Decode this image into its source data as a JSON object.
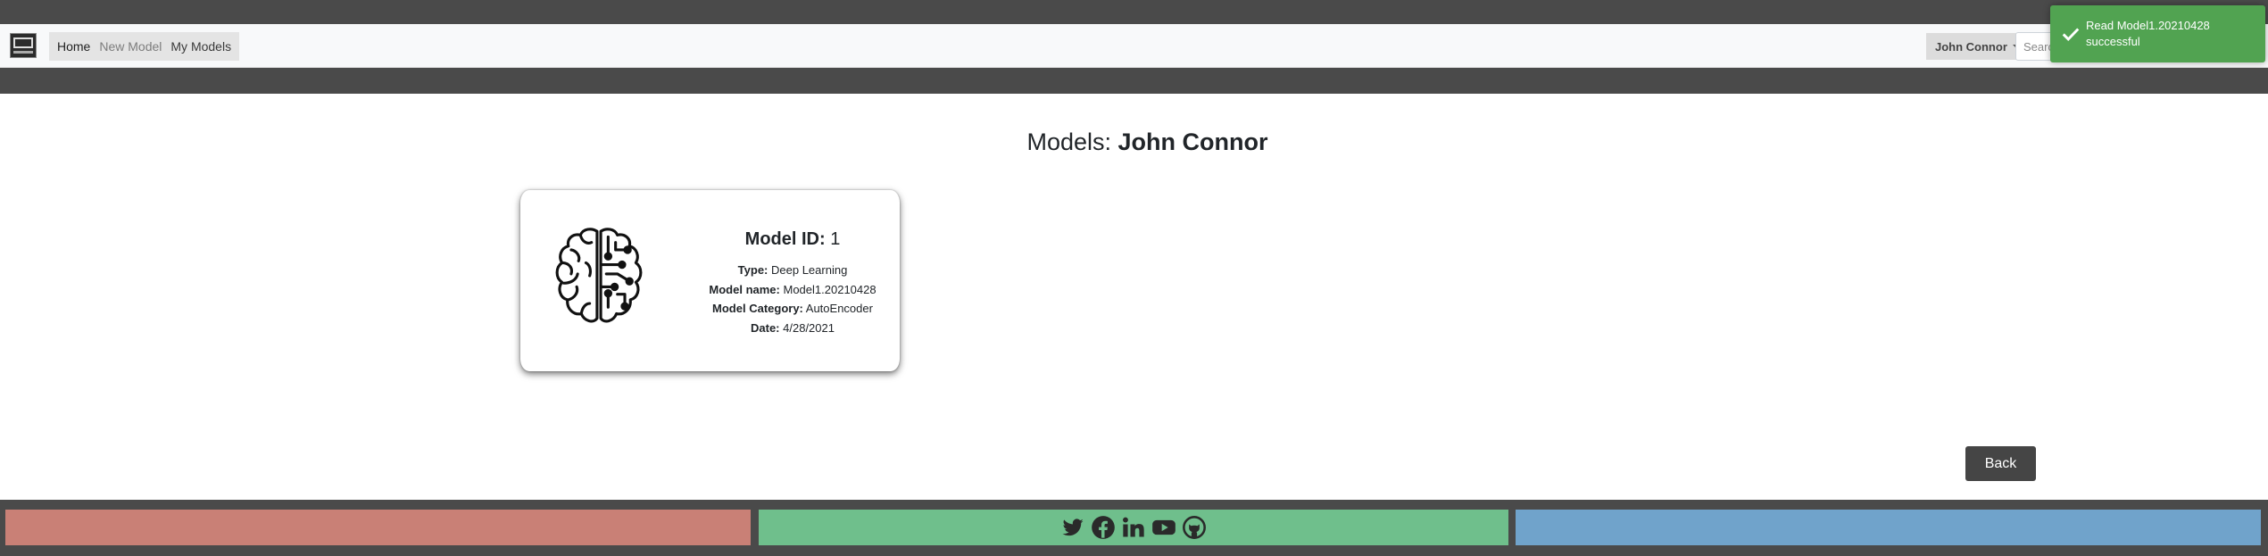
{
  "navbar": {
    "logo": "site-logo",
    "links": [
      "Home",
      "New Model",
      "My Models"
    ],
    "user": "John Connor",
    "search_placeholder": "Search"
  },
  "toast": {
    "message": "Read Model1.20210428 successful",
    "icon": "check-icon",
    "color": "#51a351"
  },
  "page": {
    "title_prefix": "Models:",
    "title_name": "John Connor"
  },
  "model_card": {
    "icon": "brain-circuit-icon",
    "id_label": "Model ID:",
    "id_value": "1",
    "fields": [
      {
        "label": "Type:",
        "value": "Deep Learning"
      },
      {
        "label": "Model name:",
        "value": "Model1.20210428"
      },
      {
        "label": "Model Category:",
        "value": "AutoEncoder"
      },
      {
        "label": "Date:",
        "value": "4/28/2021"
      }
    ]
  },
  "back_button": "Back",
  "footer": {
    "social_icons": [
      "twitter-icon",
      "facebook-icon",
      "linkedin-icon",
      "youtube-icon",
      "github-icon"
    ],
    "colors": [
      "#c98076",
      "#6fbf8c",
      "#70a3cb"
    ]
  }
}
